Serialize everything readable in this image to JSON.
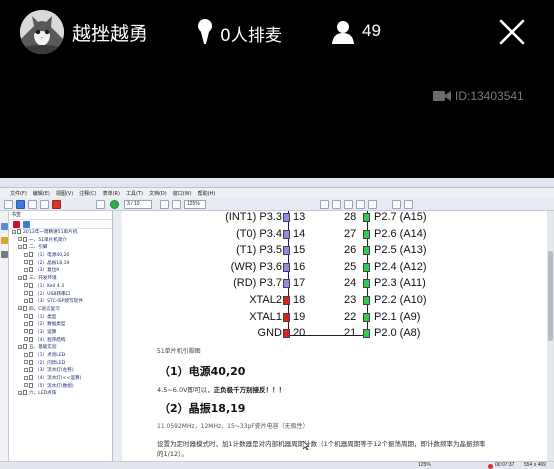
{
  "room": {
    "host_name": "越挫越勇",
    "mic_queue": "0人排麦",
    "viewer_count": "49",
    "room_id_label": "ID:13403541"
  },
  "viewer": {
    "menu": [
      "文件(F)",
      "编辑(E)",
      "视图(V)",
      "注释(C)",
      "表单(R)",
      "工具(T)",
      "文档(D)",
      "窗口(W)",
      "帮助(H)"
    ],
    "bookmarks_header": "书签",
    "bookmarks": [
      {
        "indent": 0,
        "label": "2013年一周精讲51单片机"
      },
      {
        "indent": 1,
        "label": "一、51单片机简介"
      },
      {
        "indent": 1,
        "label": "二、引脚"
      },
      {
        "indent": 2,
        "label": "（1）电源40,20"
      },
      {
        "indent": 2,
        "label": "（2）晶振18,19"
      },
      {
        "indent": 2,
        "label": "（3）复位9"
      },
      {
        "indent": 1,
        "label": "三、开发环境"
      },
      {
        "indent": 2,
        "label": "（1）Keil 4.3"
      },
      {
        "indent": 2,
        "label": "（2）USB转串口"
      },
      {
        "indent": 2,
        "label": "（3）STC-ISP烧写软件"
      },
      {
        "indent": 1,
        "label": "四、C语言复习"
      },
      {
        "indent": 2,
        "label": "（1）类型"
      },
      {
        "indent": 2,
        "label": "（2）数据类型"
      },
      {
        "indent": 2,
        "label": "（3）运算"
      },
      {
        "indent": 2,
        "label": "（4）程序结构"
      },
      {
        "indent": 1,
        "label": "五、基础实验"
      },
      {
        "indent": 2,
        "label": "（1）点亮LED"
      },
      {
        "indent": 2,
        "label": "（2）闪烁LED"
      },
      {
        "indent": 2,
        "label": "（3）流水灯(左移)"
      },
      {
        "indent": 2,
        "label": "（4）流水灯(<<运算)"
      },
      {
        "indent": 2,
        "label": "（5）流水灯(数组)"
      },
      {
        "indent": 1,
        "label": "六、LED点阵"
      }
    ],
    "zoom": "125%",
    "page_indicator": "3 / 10",
    "rec_time": "00:07:37",
    "status_right": "554 x 469"
  },
  "doc": {
    "pins_left": [
      {
        "label": "(INT1) P3.3",
        "num": "13",
        "color": "#8c8cf0"
      },
      {
        "label": "(T0) P3.4",
        "num": "14",
        "color": "#8c8cf0"
      },
      {
        "label": "(T1) P3.5",
        "num": "15",
        "color": "#8c8cf0"
      },
      {
        "label": "(WR) P3.6",
        "num": "16",
        "color": "#8c8cf0"
      },
      {
        "label": "(RD) P3.7",
        "num": "17",
        "color": "#8c8cf0"
      },
      {
        "label": "XTAL2",
        "num": "18",
        "color": "#e0201c"
      },
      {
        "label": "XTAL1",
        "num": "19",
        "color": "#e0201c"
      },
      {
        "label": "GND",
        "num": "20",
        "color": "#e0201c"
      }
    ],
    "pins_right": [
      {
        "label": "P2.7 (A15)",
        "num": "28",
        "color": "#2fcf4a"
      },
      {
        "label": "P2.6 (A14)",
        "num": "27",
        "color": "#2fcf4a"
      },
      {
        "label": "P2.5 (A13)",
        "num": "26",
        "color": "#2fcf4a"
      },
      {
        "label": "P2.4 (A12)",
        "num": "25",
        "color": "#2fcf4a"
      },
      {
        "label": "P2.3 (A11)",
        "num": "24",
        "color": "#2fcf4a"
      },
      {
        "label": "P2.2 (A10)",
        "num": "23",
        "color": "#2fcf4a"
      },
      {
        "label": "P2.1 (A9)",
        "num": "22",
        "color": "#2fcf4a"
      },
      {
        "label": "P2.0 (A8)",
        "num": "21",
        "color": "#2fcf4a"
      }
    ],
    "caption": "51单片机引脚图",
    "heading1": "（1）电源40,20",
    "para1_a": "4.5~6.0V即可以，",
    "para1_b": "正负极千万别接反！！！",
    "heading2": "（2）晶振18,19",
    "para2": "11.0592MHz，12MHz，15~33pF瓷片电容（无极性）",
    "para3": "设置为定时器模式时，加1计数器是对内部机器周期计数（1个机器周期等于12个振荡周期，即计数频率为晶振频率",
    "para4": "的1/12）。"
  },
  "colors": {
    "background": "#000000",
    "overlay_text": "#ffffff",
    "room_id_text": "#7a7a7a"
  }
}
